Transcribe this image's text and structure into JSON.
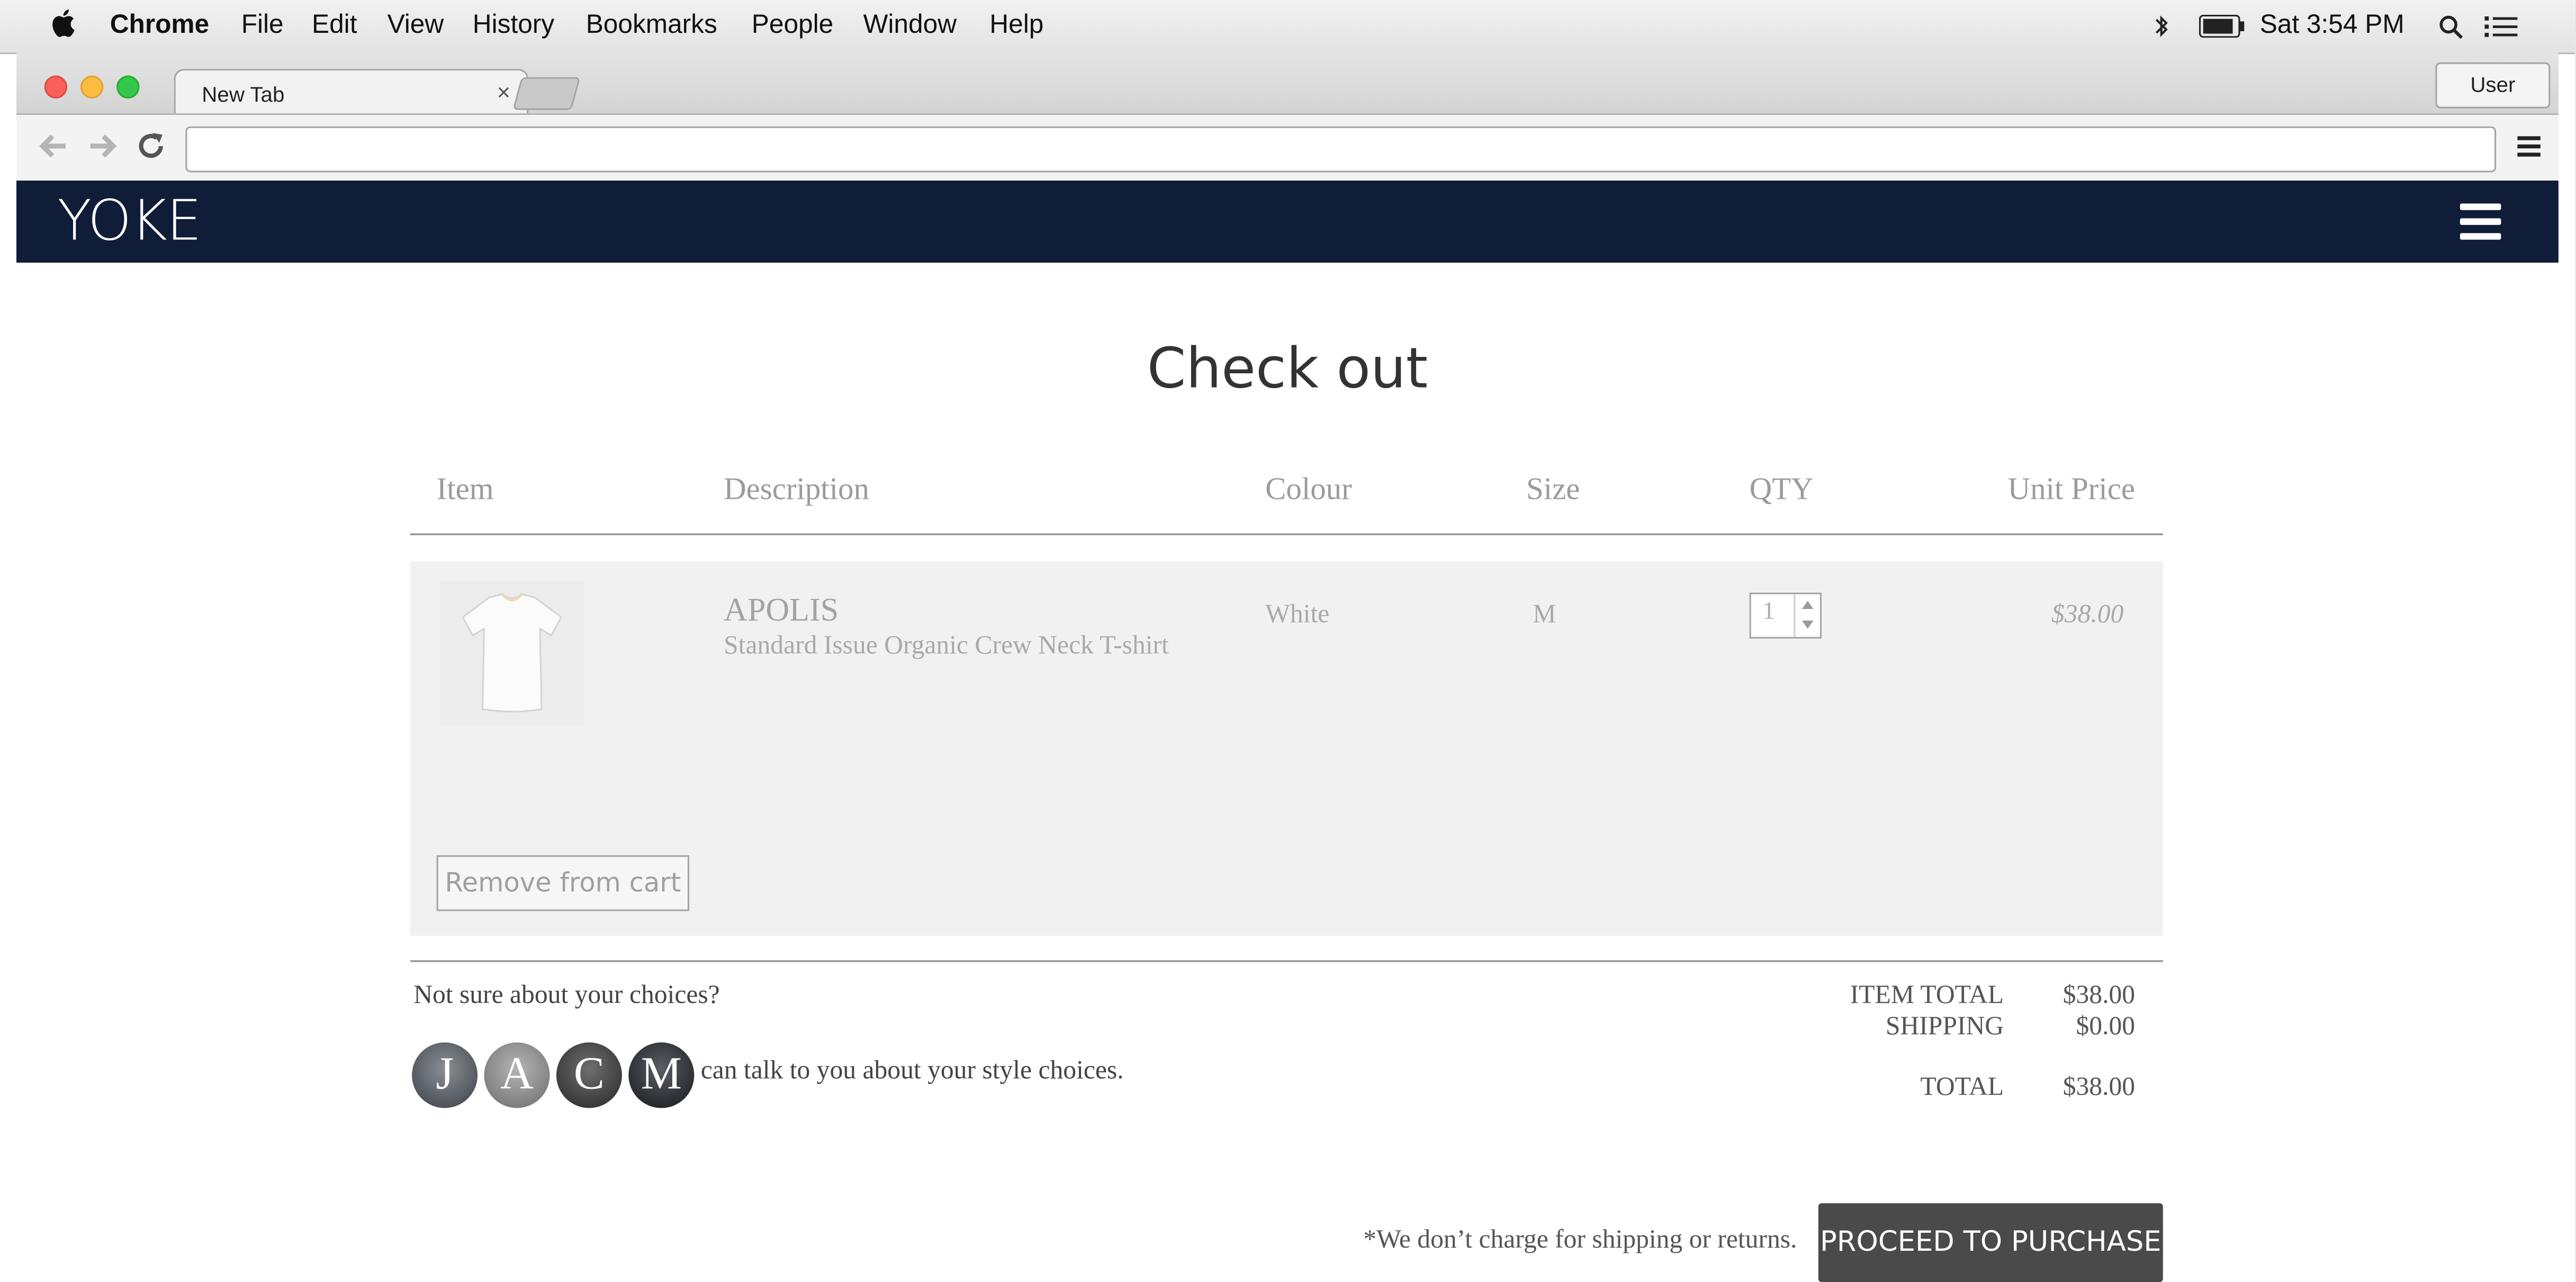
{
  "menubar": {
    "app": "Chrome",
    "items": [
      "File",
      "Edit",
      "View",
      "History",
      "Bookmarks",
      "People",
      "Window",
      "Help"
    ],
    "clock": "Sat 3:54 PM"
  },
  "browser": {
    "tab_title": "New Tab",
    "tab_close": "×",
    "user_button": "User",
    "address_value": ""
  },
  "site": {
    "logo": "YOKE"
  },
  "checkout": {
    "title": "Check out",
    "columns": [
      "Item",
      "Description",
      "Colour",
      "Size",
      "QTY",
      "Unit Price"
    ],
    "product": {
      "name": "APOLIS",
      "description": "Standard Issue Organic Crew Neck T-shirt",
      "colour": "White",
      "size": "M",
      "qty": "1",
      "unit_price": "$38.00"
    },
    "remove_label": "Remove from cart",
    "help_question": "Not sure about your choices?",
    "stylists": [
      "J",
      "A",
      "C",
      "M"
    ],
    "help_text": "can talk to you about your style choices.",
    "totals": {
      "item_total_label": "ITEM TOTAL",
      "item_total": "$38.00",
      "shipping_label": "SHIPPING",
      "shipping": "$0.00",
      "total_label": "TOTAL",
      "total": "$38.00"
    },
    "shipping_note": "*We don’t charge for shipping or returns.",
    "proceed_label": "PROCEED TO PURCHASE"
  }
}
